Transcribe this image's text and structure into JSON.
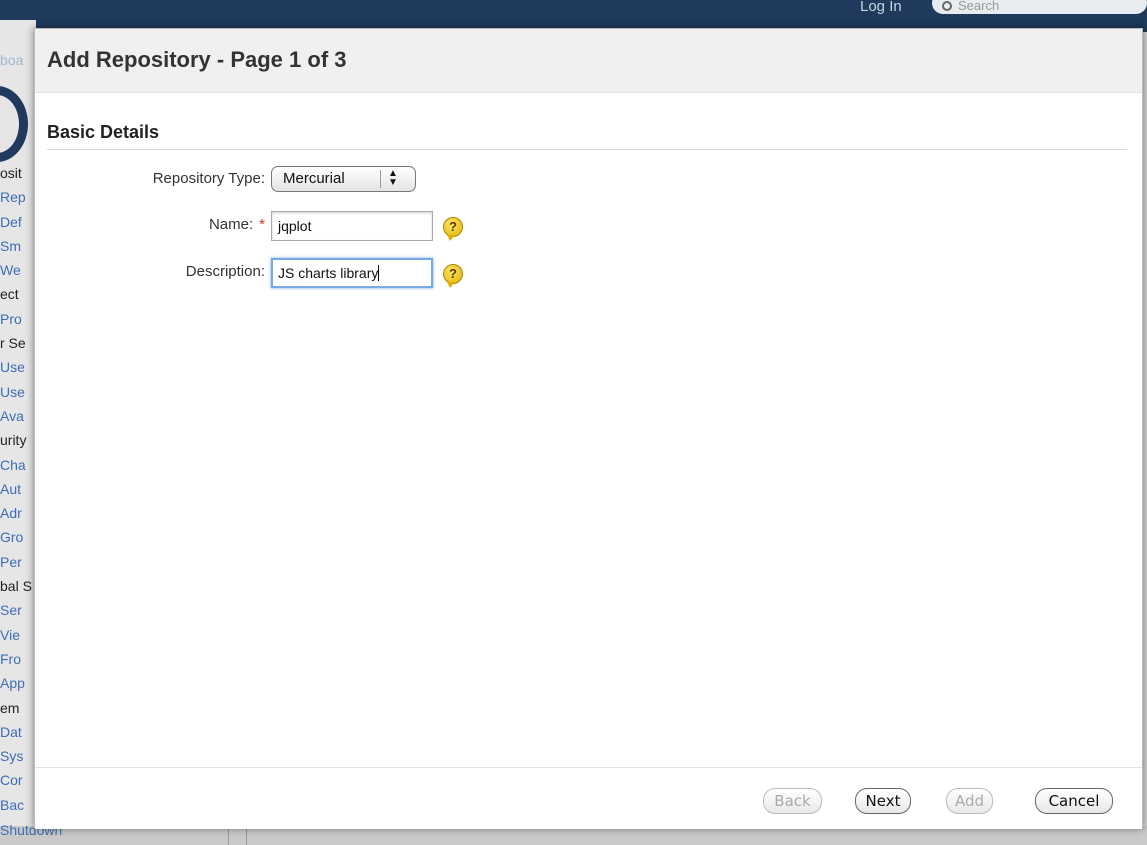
{
  "background": {
    "login_text": "Log In",
    "search_placeholder": "Search",
    "dashboard_fragment": "boa",
    "nav": [
      {
        "text": "osit",
        "type": "head"
      },
      {
        "text": "Rep",
        "type": "link"
      },
      {
        "text": "Def",
        "type": "link"
      },
      {
        "text": "Sm",
        "type": "link"
      },
      {
        "text": "We",
        "type": "link"
      },
      {
        "text": "ect",
        "type": "head"
      },
      {
        "text": "Pro",
        "type": "link"
      },
      {
        "text": "r Se",
        "type": "head"
      },
      {
        "text": "Use",
        "type": "link"
      },
      {
        "text": "Use",
        "type": "link"
      },
      {
        "text": "Ava",
        "type": "link"
      },
      {
        "text": "urity",
        "type": "head"
      },
      {
        "text": "Cha",
        "type": "link"
      },
      {
        "text": "Aut",
        "type": "link"
      },
      {
        "text": "Adr",
        "type": "link"
      },
      {
        "text": "Gro",
        "type": "link"
      },
      {
        "text": "Per",
        "type": "link"
      },
      {
        "text": "bal S",
        "type": "head"
      },
      {
        "text": "Ser",
        "type": "link"
      },
      {
        "text": "Vie",
        "type": "link"
      },
      {
        "text": "Fro",
        "type": "link"
      },
      {
        "text": "App",
        "type": "link"
      },
      {
        "text": "em",
        "type": "head"
      },
      {
        "text": "Dat",
        "type": "link"
      },
      {
        "text": "Sys",
        "type": "link"
      },
      {
        "text": "Cor",
        "type": "link"
      },
      {
        "text": "Bac",
        "type": "link"
      }
    ],
    "shutdown_text": "Shutdown"
  },
  "dialog": {
    "title": "Add Repository - Page 1 of 3",
    "section_title": "Basic Details",
    "fields": {
      "repo_type": {
        "label": "Repository Type:",
        "value": "Mercurial"
      },
      "name": {
        "label": "Name:",
        "required_mark": "*",
        "value": "jqplot"
      },
      "description": {
        "label": "Description:",
        "value": "JS charts library"
      }
    },
    "help_icon_glyph": "?",
    "buttons": {
      "back": "Back",
      "next": "Next",
      "add": "Add",
      "cancel": "Cancel"
    }
  },
  "colors": {
    "header_bg": "#1f3a5c",
    "link": "#3d6db5",
    "required": "#c0392b",
    "focus_ring": "#7aa8e0",
    "help_icon": "#ffd83a"
  }
}
